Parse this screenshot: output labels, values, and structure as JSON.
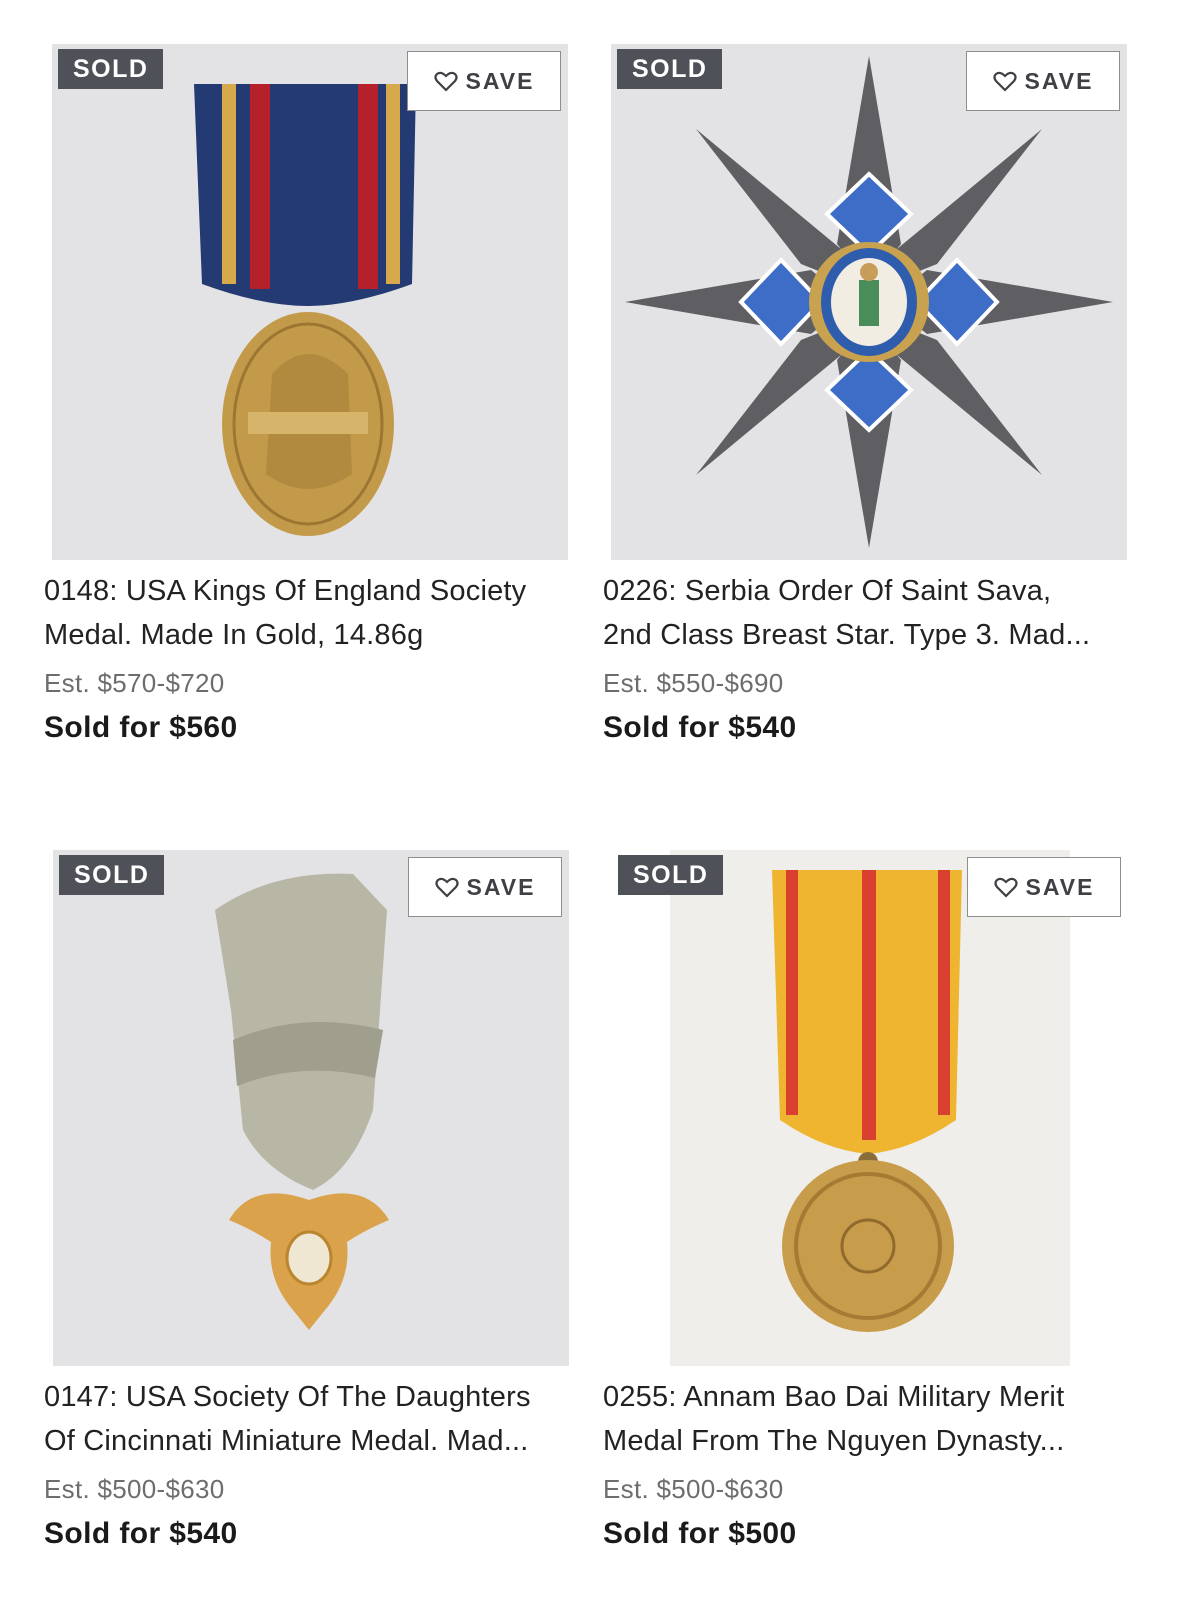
{
  "lots": [
    {
      "badge": "SOLD",
      "save_label": "SAVE",
      "title_line1": "0148: USA Kings Of England Society",
      "title_line2": "Medal. Made In Gold, 14.86g",
      "estimate": "Est. $570-$720",
      "sold_for": "Sold for $560",
      "image": "gold-oval-medal-blue-ribbon"
    },
    {
      "badge": "SOLD",
      "save_label": "SAVE",
      "title_line1": "0226: Serbia Order Of Saint Sava,",
      "title_line2": "2nd Class Breast Star. Type 3. Mad...",
      "estimate": "Est. $550-$690",
      "sold_for": "Sold for $540",
      "image": "silver-breast-star-blue-cross"
    },
    {
      "badge": "SOLD",
      "save_label": "SAVE",
      "title_line1": "0147: USA Society Of The Daughters",
      "title_line2": "Of Cincinnati Miniature Medal. Mad...",
      "estimate": "Est. $500-$630",
      "sold_for": "Sold for $540",
      "image": "gold-eagle-medal-gray-ribbon"
    },
    {
      "badge": "SOLD",
      "save_label": "SAVE",
      "title_line1": "0255: Annam Bao Dai Military Merit",
      "title_line2": "Medal From The Nguyen Dynasty...",
      "estimate": "Est. $500-$630",
      "sold_for": "Sold for $500",
      "image": "bronze-round-medal-yellow-ribbon"
    }
  ],
  "icons": {
    "save": "heart-icon"
  },
  "colors": {
    "badge_bg": "#4e5157",
    "save_border": "#8e8e8e"
  }
}
